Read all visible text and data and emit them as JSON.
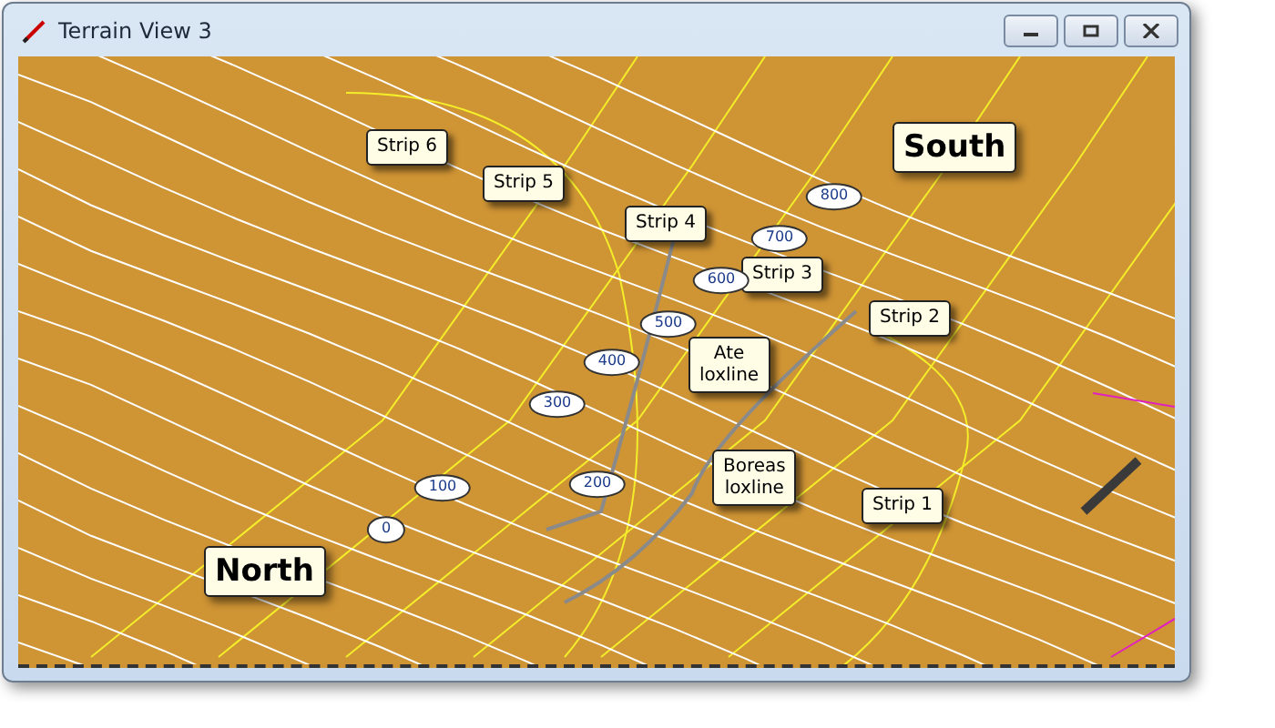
{
  "window": {
    "title": "Terrain View 3"
  },
  "labels": [
    {
      "kind": "callout",
      "text": "Strip 6"
    },
    {
      "kind": "callout",
      "text": "Strip 5"
    },
    {
      "kind": "callout",
      "text": "Strip 4"
    },
    {
      "kind": "callout",
      "text": "Strip 3"
    },
    {
      "kind": "callout",
      "text": "Strip 2"
    },
    {
      "kind": "callout",
      "text": "Strip 1"
    },
    {
      "kind": "callout",
      "text": "Ate loxline"
    },
    {
      "kind": "callout",
      "text": "Boreas loxline"
    },
    {
      "kind": "marker",
      "text": "800"
    },
    {
      "kind": "marker",
      "text": "700"
    },
    {
      "kind": "marker",
      "text": "600"
    },
    {
      "kind": "marker",
      "text": "500"
    },
    {
      "kind": "marker",
      "text": "400"
    },
    {
      "kind": "marker",
      "text": "300"
    },
    {
      "kind": "marker",
      "text": "100"
    },
    {
      "kind": "marker",
      "text": "200"
    },
    {
      "kind": "marker",
      "text": "0"
    },
    {
      "kind": "place",
      "text": "North"
    },
    {
      "kind": "place",
      "text": "South"
    }
  ]
}
